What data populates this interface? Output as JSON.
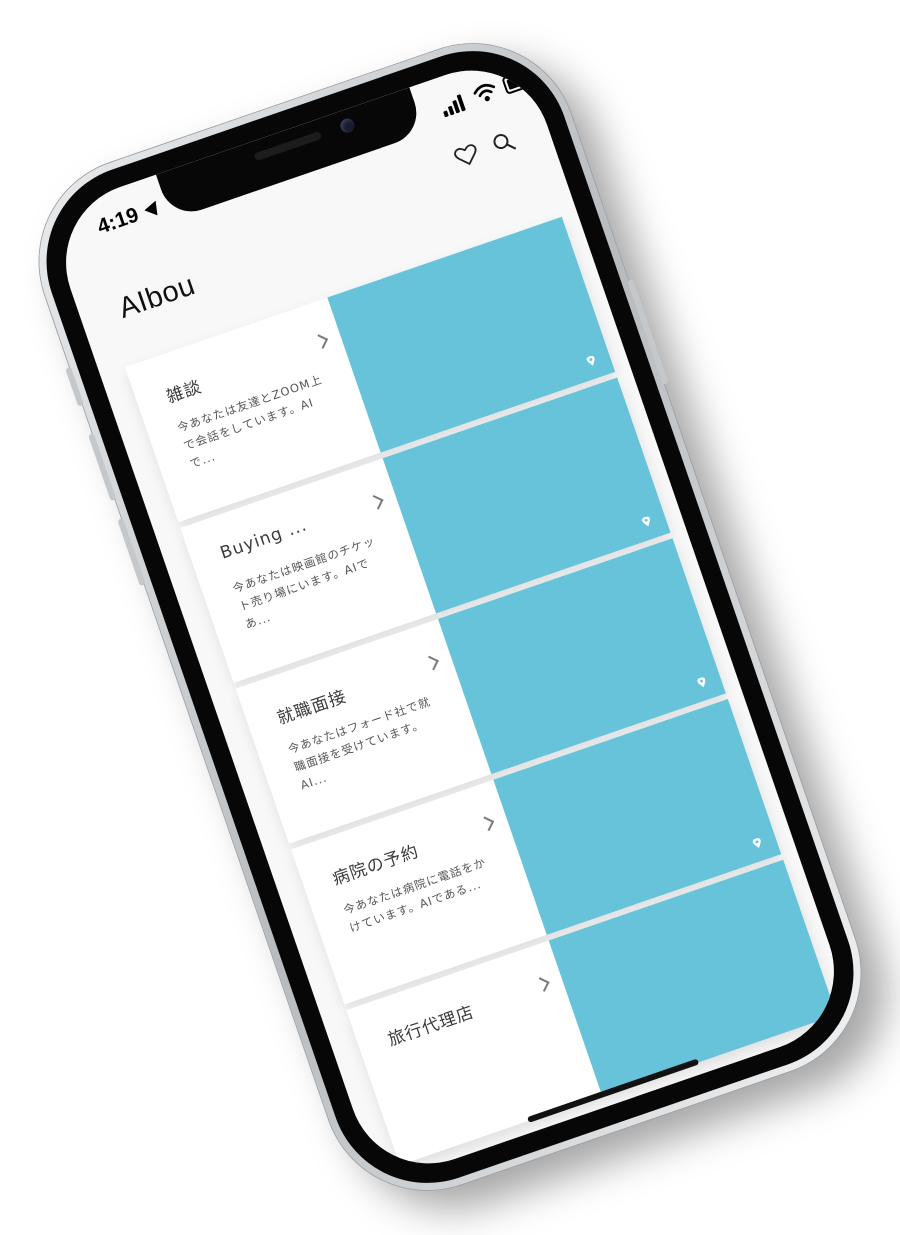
{
  "status_bar": {
    "time": "4:19",
    "battery_level": 0.85
  },
  "header": {
    "app_title": "AIbou"
  },
  "icons": {
    "favorites": "heart-icon",
    "search": "search-icon"
  },
  "colors": {
    "card_image": "#66c3da",
    "background": "#f8f8f8"
  },
  "cards": [
    {
      "title": "雑談",
      "description": "今あなたは友達とZOOM上で会話をしています。AIで..."
    },
    {
      "title": "Buying ...",
      "description": "今あなたは映画館のチケット売り場にいます。AIであ..."
    },
    {
      "title": "就職面接",
      "description": "今あなたはフォード社で就職面接を受けています。AI..."
    },
    {
      "title": "病院の予約",
      "description": "今あなたは病院に電話をかけています。AIである..."
    },
    {
      "title": "旅行代理店",
      "description": ""
    }
  ]
}
